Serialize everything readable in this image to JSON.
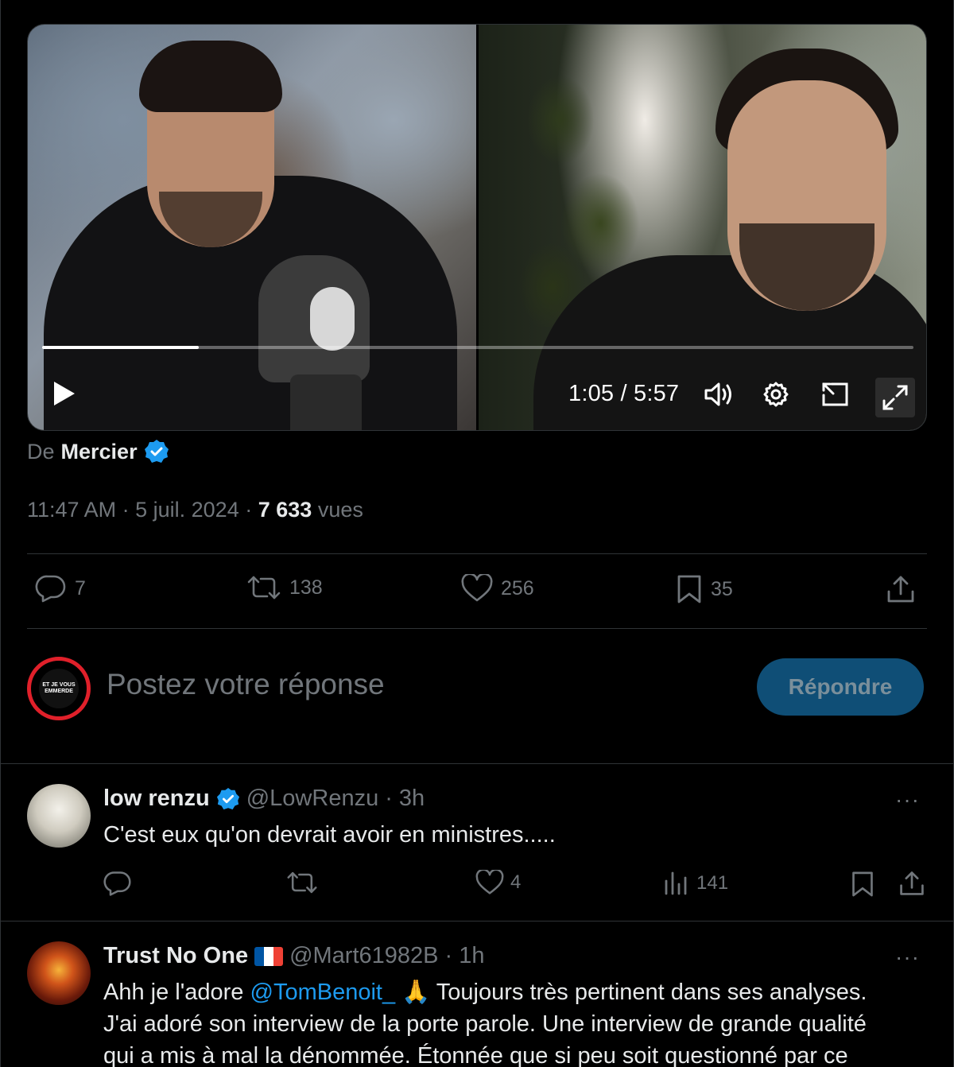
{
  "video": {
    "time": "1:05 / 5:57",
    "progress_fraction": 0.18
  },
  "tweet": {
    "from_prefix": "De",
    "from_name": "Mercier",
    "time": "11:47 AM",
    "date": "5 juil. 2024",
    "views_count": "7 633",
    "views_label": "vues",
    "sep": "·",
    "replies": "7",
    "retweets": "138",
    "likes": "256",
    "bookmarks": "35"
  },
  "composer": {
    "placeholder": "Postez votre réponse",
    "button_label": "Répondre",
    "avatar_text": "ET JE VOUS EMMERDE"
  },
  "replies": [
    {
      "name": "low renzu",
      "handle": "@LowRenzu",
      "age": "3h",
      "text": "C'est eux qu'on devrait avoir en ministres.....",
      "replies": "",
      "retweets": "",
      "likes": "4",
      "views": "141",
      "more": "···"
    },
    {
      "name": "Trust No One",
      "handle": "@Mart61982B",
      "age": "1h",
      "text_before": "Ahh je l'adore ",
      "mention": "@TomBenoit_",
      "text_after": " 🙏 Toujours très pertinent dans ses analyses.",
      "line2": "J'ai adoré son interview de la porte parole. Une interview de grande qualité",
      "line3": "qui a mis à mal la dénommée. Étonnée que si peu soit questionné par ce",
      "more": "···"
    }
  ],
  "colors": {
    "accent": "#1d9bf0",
    "muted": "#71767b",
    "text": "#e7e9ea",
    "border": "#2f3336",
    "reply_button_bg": "#0f4e76"
  }
}
